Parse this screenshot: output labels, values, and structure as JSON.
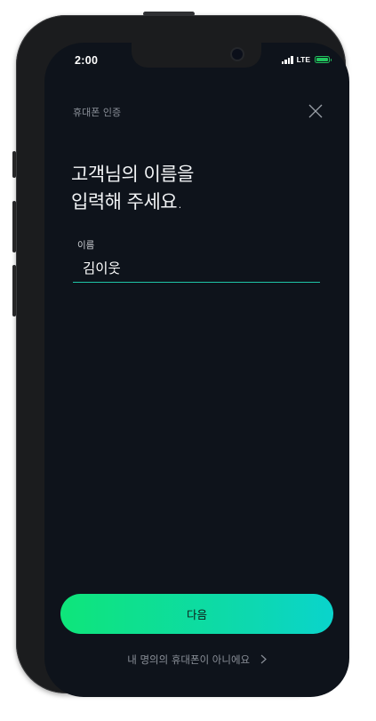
{
  "status_bar": {
    "time": "2:00",
    "network": "LTE",
    "signal_bars": 4,
    "battery_level": 1.0,
    "battery_color": "#22c55e"
  },
  "header": {
    "title": "휴대폰 인증",
    "close_icon": "close-icon"
  },
  "main": {
    "headline_line1": "고객님의 이름을",
    "headline_line2": "입력해 주세요.",
    "name_field": {
      "label": "이름",
      "value": "김이웃"
    }
  },
  "footer": {
    "next_label": "다음",
    "alt_link_label": "내 명의의 휴대폰이 아니에요",
    "alt_link_icon": "chevron-right-icon"
  },
  "colors": {
    "background": "#0e131b",
    "accent_start": "#0ee57a",
    "accent_end": "#0ad4cc",
    "underline": "#1fc5a6"
  }
}
